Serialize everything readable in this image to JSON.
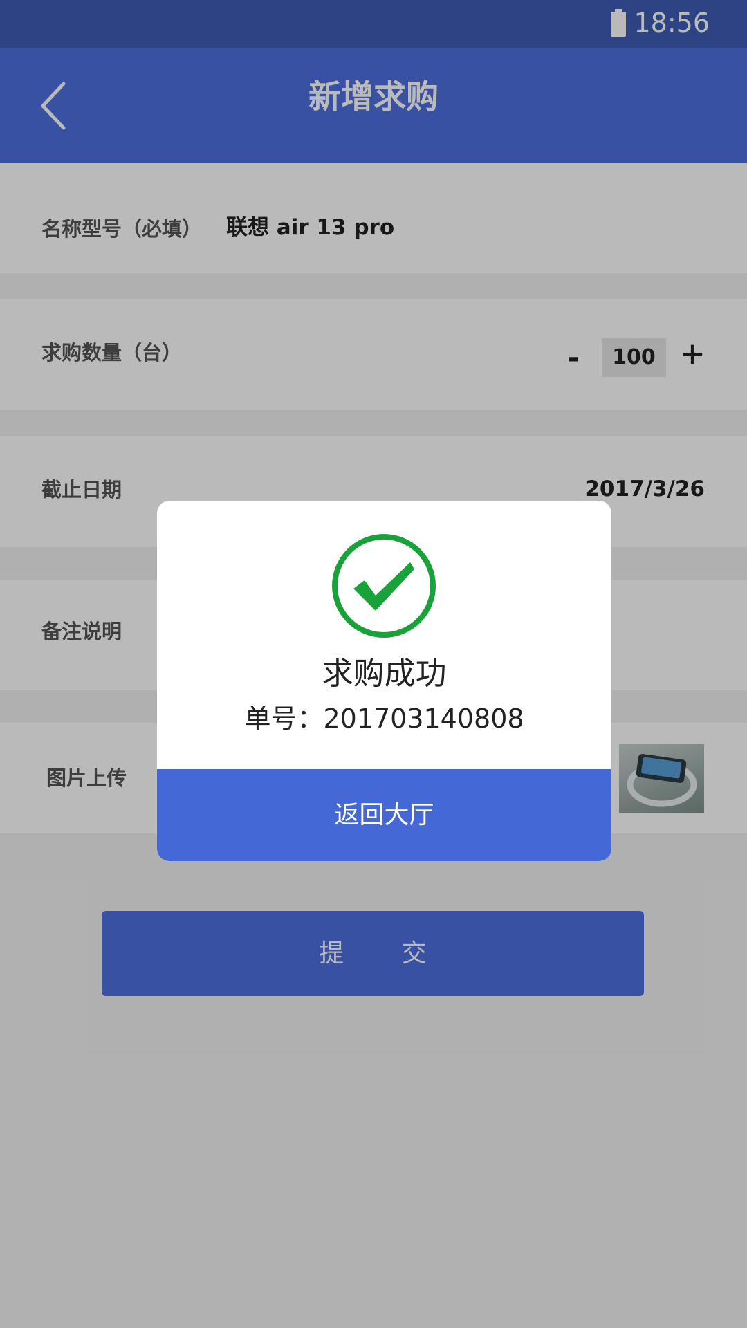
{
  "status_bar": {
    "time": "18:56",
    "battery_icon": "battery-icon"
  },
  "nav": {
    "title": "新增求购",
    "back_icon": "chevron-left-icon"
  },
  "form": {
    "name_label": "名称型号（必填）",
    "name_value": "联想 air 13 pro",
    "qty_label": "求购数量（台）",
    "qty_minus": "-",
    "qty_value": "100",
    "qty_plus": "+",
    "deadline_label": "截止日期",
    "deadline_value": "2017/3/26",
    "remark_label": "备注说明",
    "image_label": "图片上传"
  },
  "submit_label": "提 交",
  "dialog": {
    "title": "求购成功",
    "order": "单号：201703140808",
    "button_label": "返回大厅",
    "icon": "check-circle-icon"
  },
  "colors": {
    "primary": "#4e6fe0",
    "status_bar": "#3f5db6",
    "success": "#1aa23a",
    "dialog_button": "#4468d6"
  }
}
